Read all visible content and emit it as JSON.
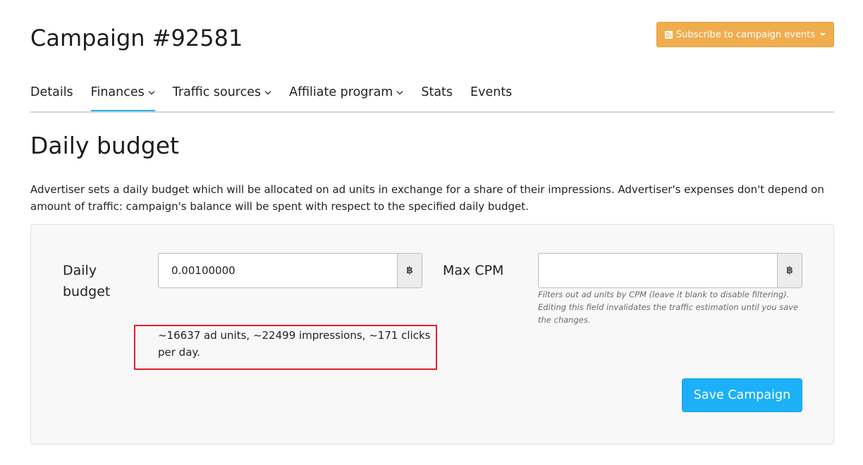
{
  "header": {
    "title": "Campaign #92581",
    "subscribe_label": "Subscribe to campaign events"
  },
  "nav": {
    "items": [
      {
        "label": "Details",
        "has_dropdown": false,
        "active": false
      },
      {
        "label": "Finances",
        "has_dropdown": true,
        "active": true
      },
      {
        "label": "Traffic sources",
        "has_dropdown": true,
        "active": false
      },
      {
        "label": "Affiliate program",
        "has_dropdown": true,
        "active": false
      },
      {
        "label": "Stats",
        "has_dropdown": false,
        "active": false
      },
      {
        "label": "Events",
        "has_dropdown": false,
        "active": false
      }
    ]
  },
  "section": {
    "title": "Daily budget",
    "description": "Advertiser sets a daily budget which will be allocated on ad units in exchange for a share of their impressions. Advertiser's expenses don't depend on amount of traffic: campaign's balance will be spent with respect to the specified daily budget."
  },
  "form": {
    "daily_budget": {
      "label": "Daily budget",
      "value": "0.00100000",
      "currency_symbol": "฿"
    },
    "max_cpm": {
      "label": "Max CPM",
      "value": "",
      "placeholder": "",
      "currency_symbol": "฿",
      "help": "Filters out ad units by CPM (leave it blank to disable filtering). Editing this field invalidates the traffic estimation until you save the changes."
    },
    "estimate": "~16637 ad units, ~22499 impressions, ~171 clicks per day.",
    "save_label": "Save Campaign"
  },
  "colors": {
    "accent": "#1cb0f6",
    "warning": "#f0ad4e",
    "highlight_border": "#e0202c",
    "panel_bg": "#f8f8f8"
  },
  "icons": {
    "subscribe": "rss-icon",
    "currency": "bitcoin-icon",
    "dropdown": "chevron-down-icon"
  }
}
